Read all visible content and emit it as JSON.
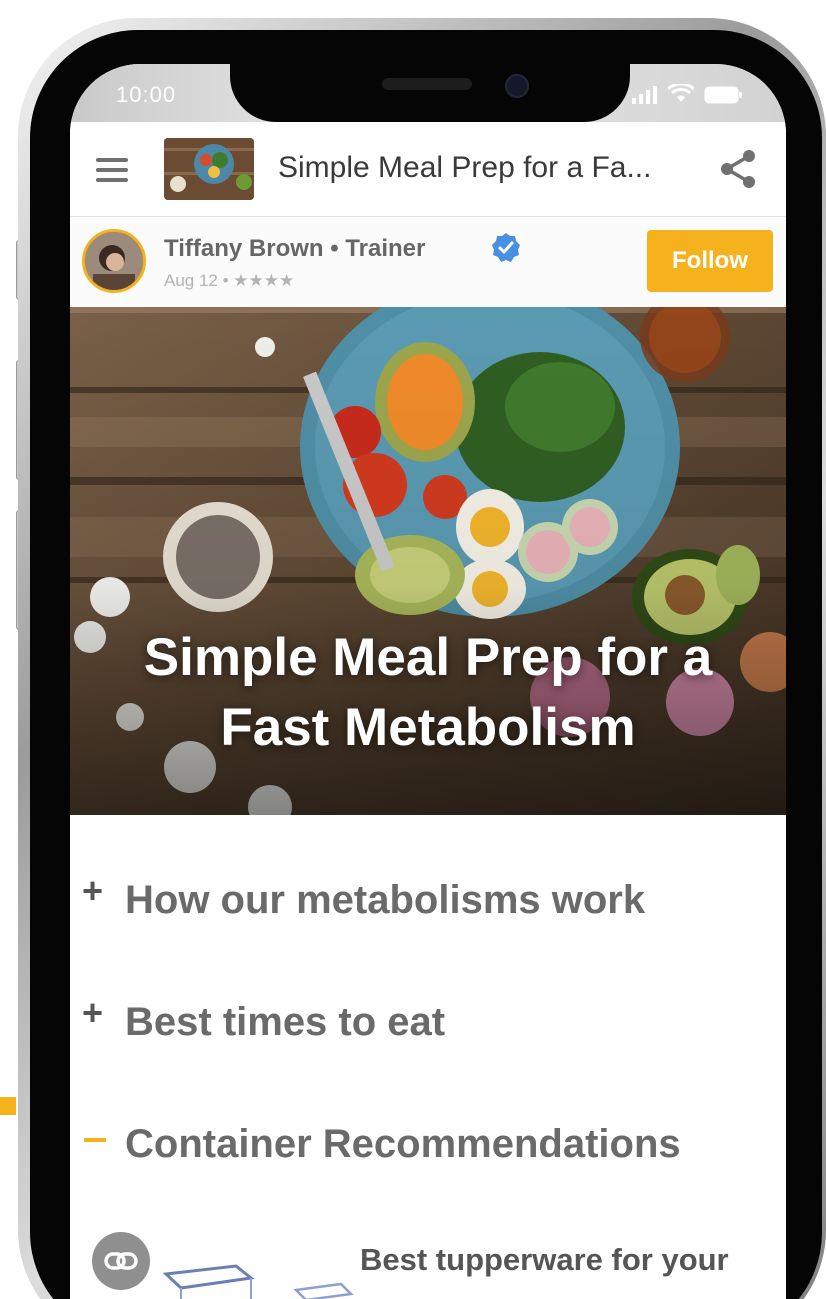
{
  "status_bar": {
    "time": "10:00"
  },
  "header": {
    "title": "Simple Meal Prep for a Fa..."
  },
  "author": {
    "name": "Tiffany Brown • Trainer",
    "meta": "Aug 12 • ★★★★",
    "follow_label": "Follow"
  },
  "hero": {
    "title_line1": "Simple Meal Prep for a",
    "title_line2": "Fast Metabolism"
  },
  "sections": [
    {
      "sign": "+",
      "title": "How our metabolisms work",
      "expanded": false
    },
    {
      "sign": "+",
      "title": "Best times to eat",
      "expanded": false
    },
    {
      "sign": "–",
      "title": "Container Recommendations",
      "expanded": true
    }
  ],
  "recommendation": {
    "text": "Best tupperware for your"
  },
  "colors": {
    "accent": "#f6b21d",
    "verified": "#4a90e2",
    "text_gray": "#6a6a6a"
  }
}
